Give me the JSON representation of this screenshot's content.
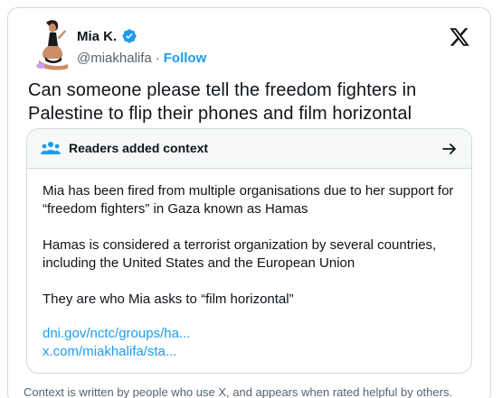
{
  "author": {
    "name": "Mia K.",
    "handle": "@miakhalifa",
    "separator": "·",
    "follow_label": "Follow",
    "avatar_icon": "avatar-photo",
    "verified_icon": "verified-badge-icon",
    "verified_color": "#1d9bf0"
  },
  "platform_icon": "x-logo-icon",
  "tweet": {
    "text": "Can someone please tell the freedom fighters in Palestine to flip their phones and film horizontal"
  },
  "context": {
    "title": "Readers added context",
    "header_icon": "people-icon",
    "arrow_icon": "arrow-right-icon",
    "paragraphs": [
      "Mia has been fired from multiple organisations due to her support for “freedom fighters” in Gaza known as Hamas",
      "Hamas is considered a terrorist organization by several countries, including the United States and the European Union",
      "They are who Mia asks to “film horizontal”"
    ],
    "links": [
      "dni.gov/nctc/groups/ha...",
      "x.com/miakhalifa/sta..."
    ]
  },
  "footer": {
    "text": "Context is written by people who use X, and appears when rated helpful by others."
  },
  "colors": {
    "link": "#1d9bf0",
    "border": "#cfd9de",
    "muted": "#536471",
    "text": "#0f1419",
    "people_icon": "#1d9bf0"
  }
}
